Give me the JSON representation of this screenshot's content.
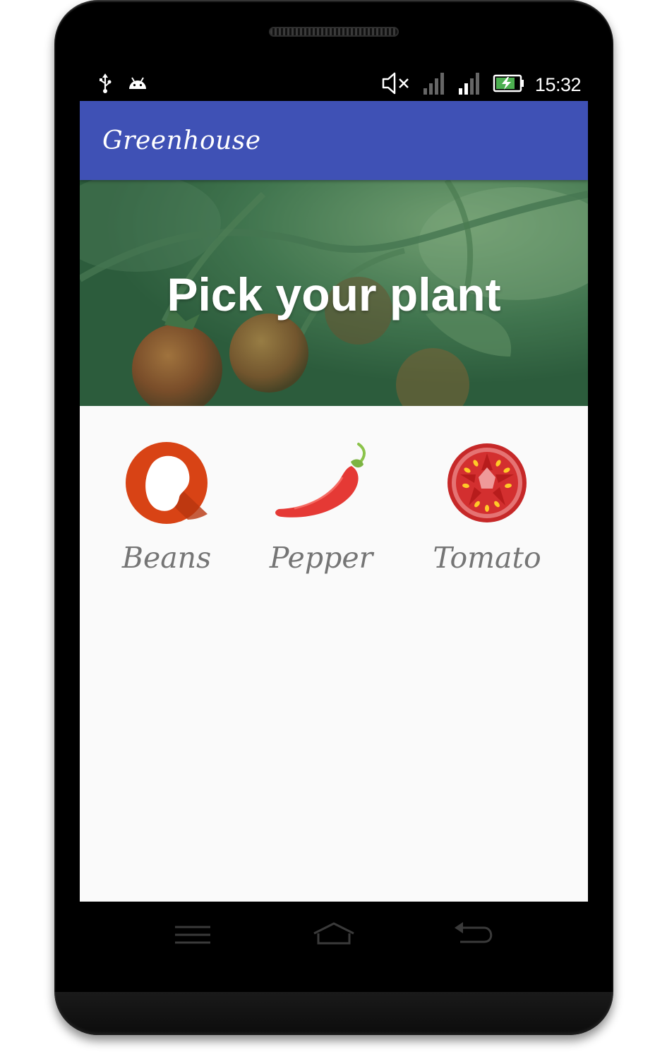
{
  "status_bar": {
    "time": "15:32",
    "left_icons": [
      "usb-icon",
      "android-icon"
    ],
    "right_icons": [
      "volume-muted-icon",
      "signal-icon",
      "signal-icon",
      "battery-charging-icon"
    ]
  },
  "app_bar": {
    "title": "Greenhouse"
  },
  "hero": {
    "title": "Pick your plant"
  },
  "plants": [
    {
      "label": "Beans",
      "icon": "beans-icon"
    },
    {
      "label": "Pepper",
      "icon": "pepper-icon"
    },
    {
      "label": "Tomato",
      "icon": "tomato-icon"
    }
  ],
  "navigation": {
    "buttons": [
      "menu-icon",
      "home-icon",
      "back-icon"
    ]
  },
  "colors": {
    "app_bar": "#3f51b5",
    "screen_bg": "#fafafa",
    "label_text": "#757575",
    "beans": "#d84315",
    "pepper": "#e53935",
    "tomato": "#c62828"
  }
}
